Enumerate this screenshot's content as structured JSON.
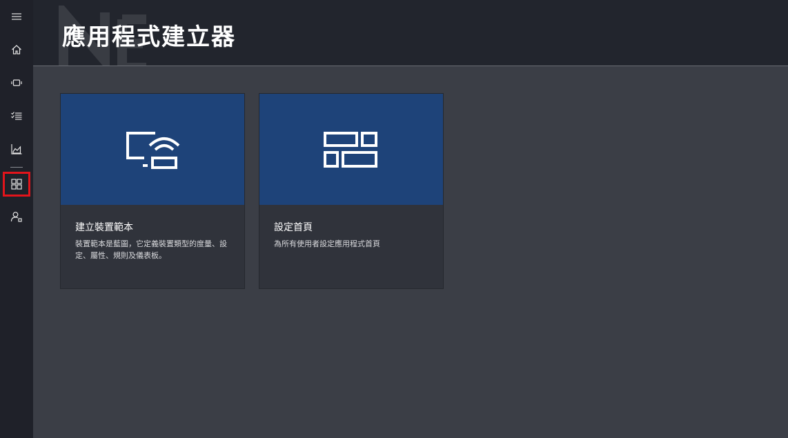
{
  "header": {
    "title": "應用程式建立器"
  },
  "rail": {
    "items": [
      {
        "icon": "hamburger-menu-icon"
      },
      {
        "icon": "home-icon"
      },
      {
        "icon": "devices-icon"
      },
      {
        "icon": "checklist-icon"
      },
      {
        "icon": "analytics-icon"
      },
      {
        "icon": "app-builder-icon",
        "selected": true
      },
      {
        "icon": "user-admin-icon"
      }
    ],
    "selected_outline_color": "#e3141b"
  },
  "cards": [
    {
      "icon": "device-template-icon",
      "title": "建立裝置範本",
      "description": "裝置範本是藍圖，它定義裝置類型的度量、設定、屬性、規則及儀表板。"
    },
    {
      "icon": "dashboard-layout-icon",
      "title": "設定首頁",
      "description": "為所有使用者設定應用程式首頁"
    }
  ],
  "colors": {
    "card_hero": "#1e4379",
    "background": "#3b3e46",
    "rail": "#1f2129"
  }
}
